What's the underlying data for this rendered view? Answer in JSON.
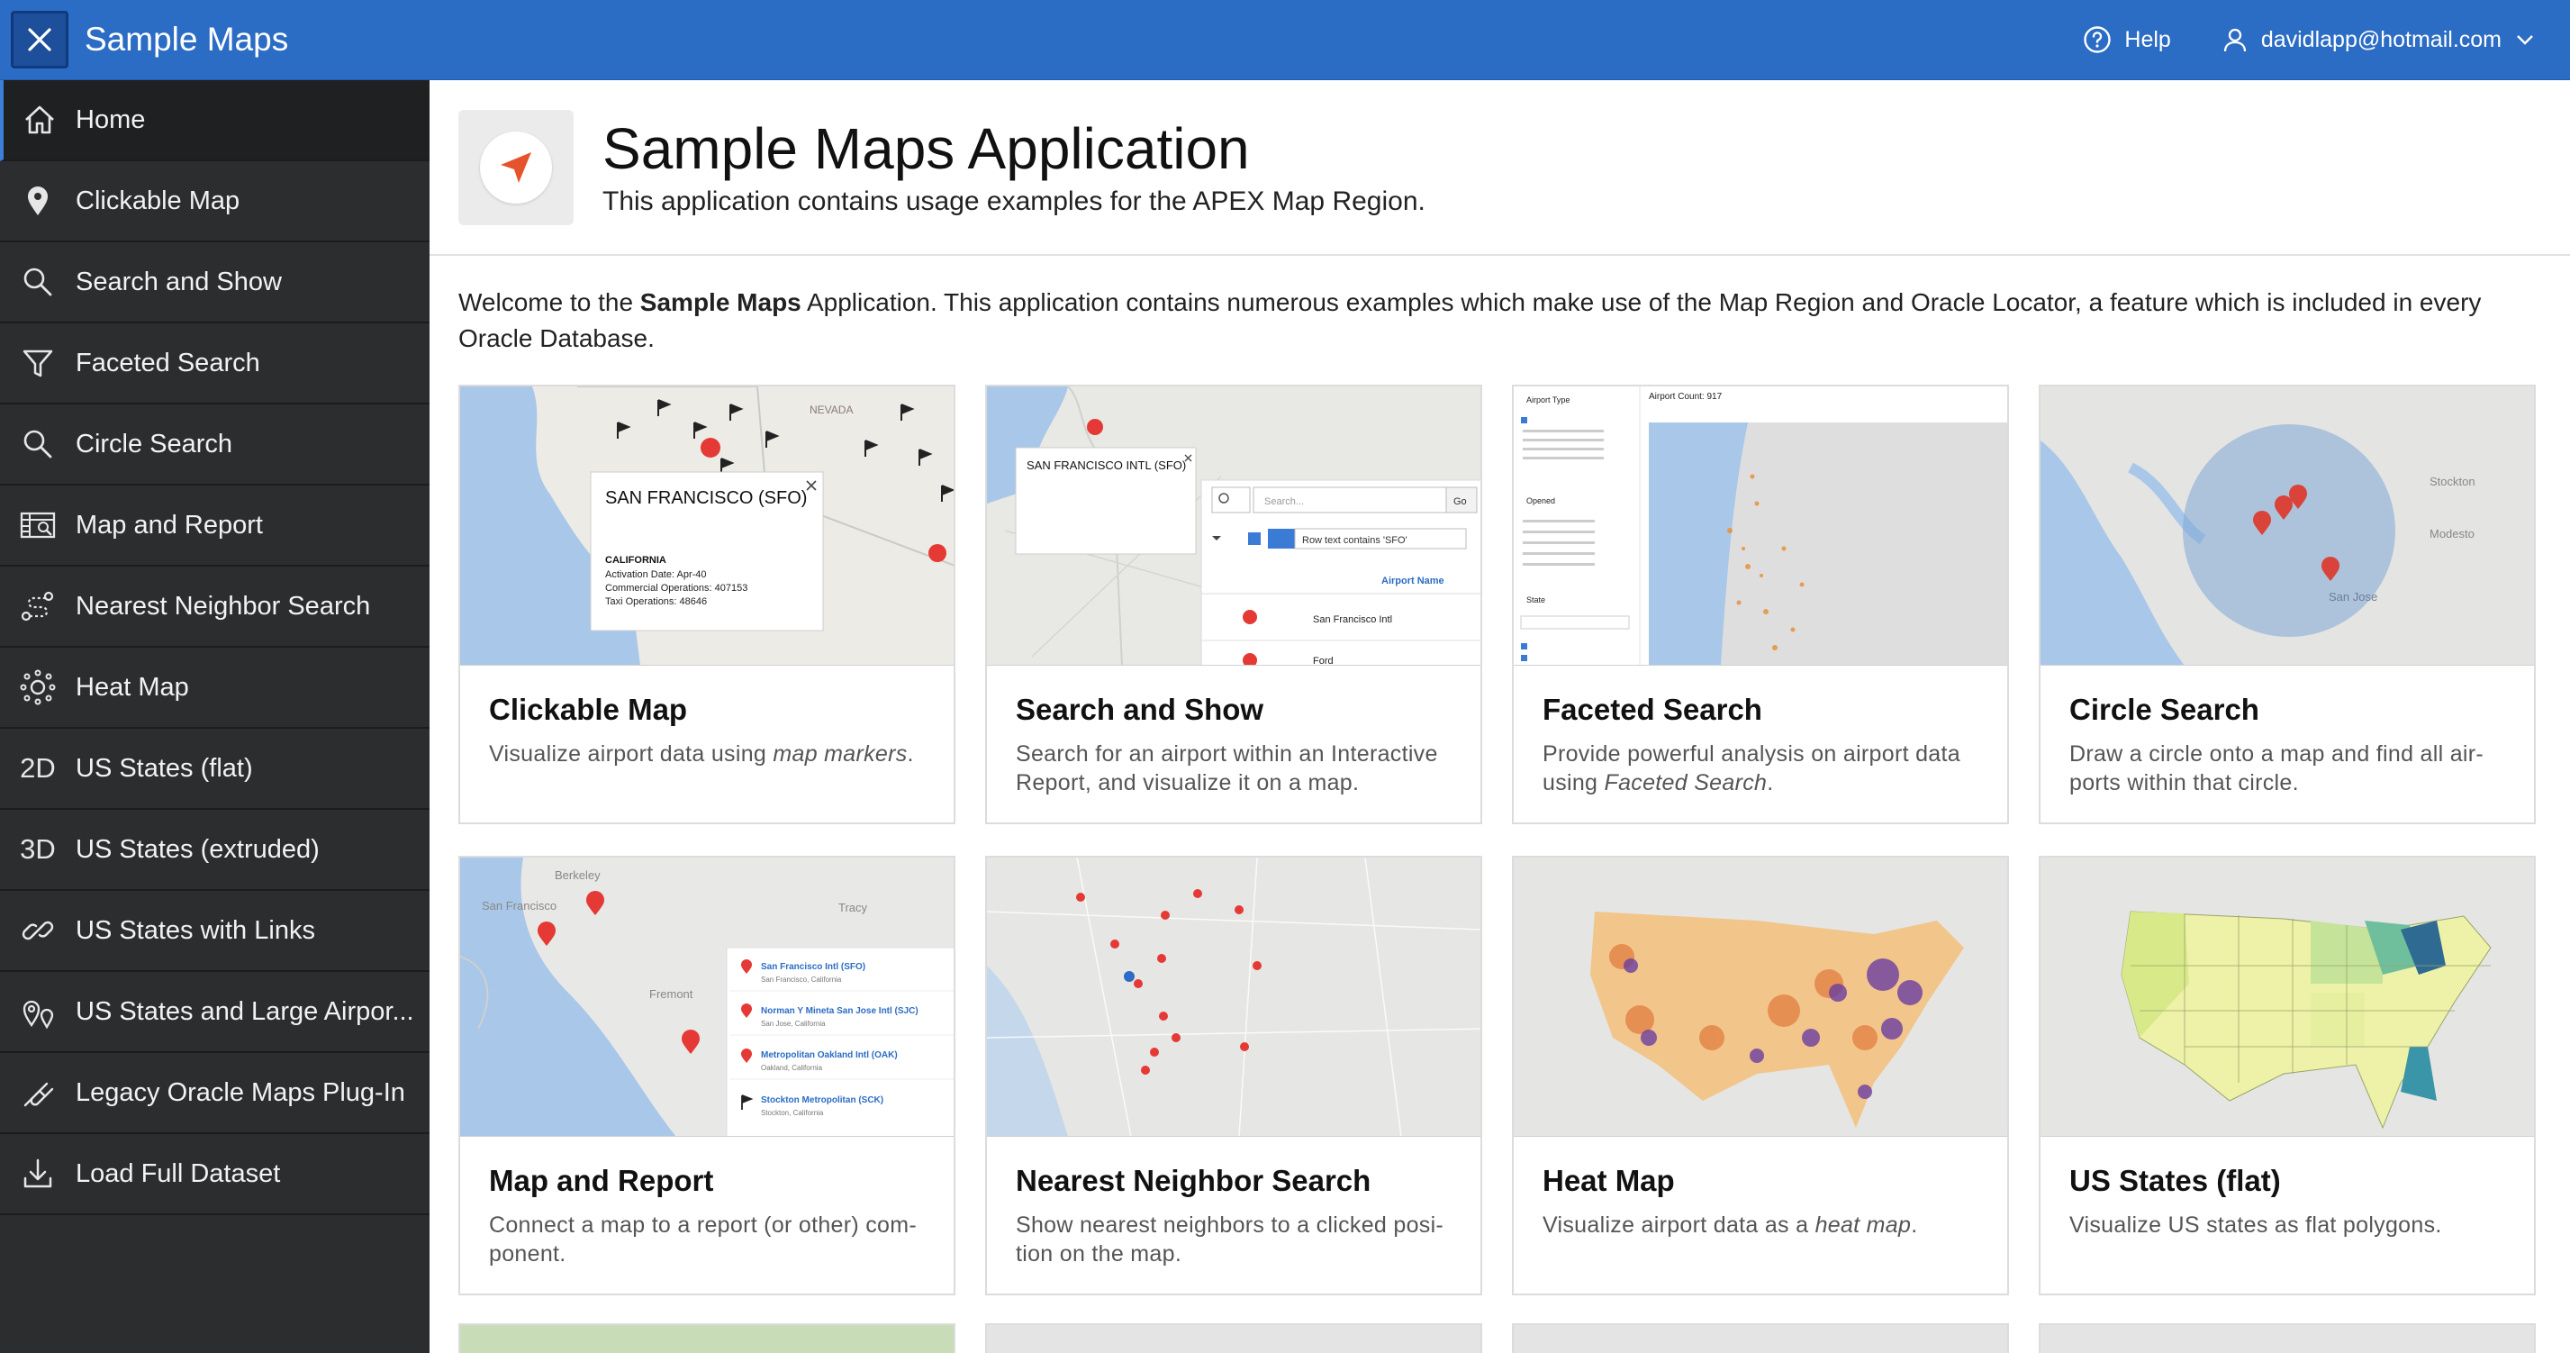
{
  "app": {
    "title": "Sample Maps",
    "help_label": "Help",
    "user_email": "davidlapp@hotmail.com"
  },
  "colors": {
    "header": "#2b6cc4",
    "sidebar": "#2b2d2f",
    "accent_marker": "#e53935",
    "hero_arrow": "#e5532d"
  },
  "sidebar": {
    "items": [
      {
        "label": "Home",
        "icon": "home-icon"
      },
      {
        "label": "Clickable Map",
        "icon": "map-pin-icon"
      },
      {
        "label": "Search and Show",
        "icon": "search-icon"
      },
      {
        "label": "Faceted Search",
        "icon": "filter-icon"
      },
      {
        "label": "Circle Search",
        "icon": "search-icon"
      },
      {
        "label": "Map and Report",
        "icon": "map-report-icon"
      },
      {
        "label": "Nearest Neighbor Search",
        "icon": "route-icon"
      },
      {
        "label": "Heat Map",
        "icon": "heat-icon"
      },
      {
        "label": "US States (flat)",
        "icon": "2d-text-icon",
        "icon_text": "2D"
      },
      {
        "label": "US States (extruded)",
        "icon": "3d-text-icon",
        "icon_text": "3D"
      },
      {
        "label": "US States with Links",
        "icon": "link-icon"
      },
      {
        "label": "US States and Large Airpor...",
        "icon": "pins-icon"
      },
      {
        "label": "Legacy Oracle Maps Plug-In",
        "icon": "plug-icon"
      },
      {
        "label": "Load Full Dataset",
        "icon": "download-icon"
      }
    ]
  },
  "hero": {
    "title": "Sample Maps Application",
    "subtitle": "This application contains usage examples for the APEX Map Region.",
    "icon": "navigation-arrow-icon"
  },
  "welcome": {
    "prefix": "Welcome to the ",
    "bold": "Sample Maps",
    "suffix": " Application. This application contains numerous examples which make use of the Map Region and Oracle Locator, a feature which is included in every Oracle Database."
  },
  "cards": [
    {
      "title": "Clickable Map",
      "desc_prefix": "Visualize airport data using ",
      "desc_em": "map markers",
      "desc_suffix": ".",
      "thumb": {
        "popup_title": "SAN FRANCISCO (SFO)",
        "popup_state": "CALIFORNIA",
        "popup_lines": [
          "Activation Date: Apr-40",
          "Commercial Operations: 407153",
          "Taxi Operations: 48646"
        ],
        "map_label": "NEVADA"
      }
    },
    {
      "title": "Search and Show",
      "desc_prefix": "Search for an airport within an Interactive Report, and visualize it on a map.",
      "desc_em": "",
      "desc_suffix": "",
      "thumb": {
        "popup_title": "SAN FRANCISCO INTL (SFO)",
        "search_placeholder": "Search...",
        "go": "Go",
        "filter_text": "Row text contains 'SFO'",
        "col_header": "Airport Name",
        "row1": "San Francisco Intl",
        "row2": "Ford"
      }
    },
    {
      "title": "Faceted Search",
      "desc_prefix": "Provide powerful analysis on airport data using ",
      "desc_em": "Faceted Search",
      "desc_suffix": ".",
      "thumb": {
        "count_label": "Airport Count: 917",
        "facet1": "Airport Type",
        "facet2": "Opened",
        "facet3": "State"
      }
    },
    {
      "title": "Circle Search",
      "desc_prefix": "Draw a circle onto a map and find all air-ports within that circle.",
      "desc_em": "",
      "desc_suffix": "",
      "thumb": {
        "label1": "Stockton",
        "label2": "Modesto",
        "label3": "San Jose"
      }
    },
    {
      "title": "Map and Report",
      "desc_prefix": "Connect a map to a report (or other) com-ponent.",
      "desc_em": "",
      "desc_suffix": "",
      "thumb": {
        "list": [
          {
            "name": "San Francisco Intl (SFO)",
            "loc": "San Francisco, California"
          },
          {
            "name": "Norman Y Mineta San Jose Intl (SJC)",
            "loc": "San Jose, California"
          },
          {
            "name": "Metropolitan Oakland Intl (OAK)",
            "loc": "Oakland, California"
          },
          {
            "name": "Stockton Metropolitan (SCK)",
            "loc": "Stockton, California"
          }
        ],
        "label1": "Berkeley",
        "label2": "Tracy",
        "label3": "San Francisco",
        "label4": "Fremont"
      }
    },
    {
      "title": "Nearest Neighbor Search",
      "desc_prefix": "Show nearest neighbors to a clicked posi-tion on the map.",
      "desc_em": "",
      "desc_suffix": ""
    },
    {
      "title": "Heat Map",
      "desc_prefix": "Visualize airport data as a ",
      "desc_em": "heat map",
      "desc_suffix": "."
    },
    {
      "title": "US States (flat)",
      "desc_prefix": "Visualize US states as flat polygons.",
      "desc_em": "",
      "desc_suffix": ""
    }
  ]
}
